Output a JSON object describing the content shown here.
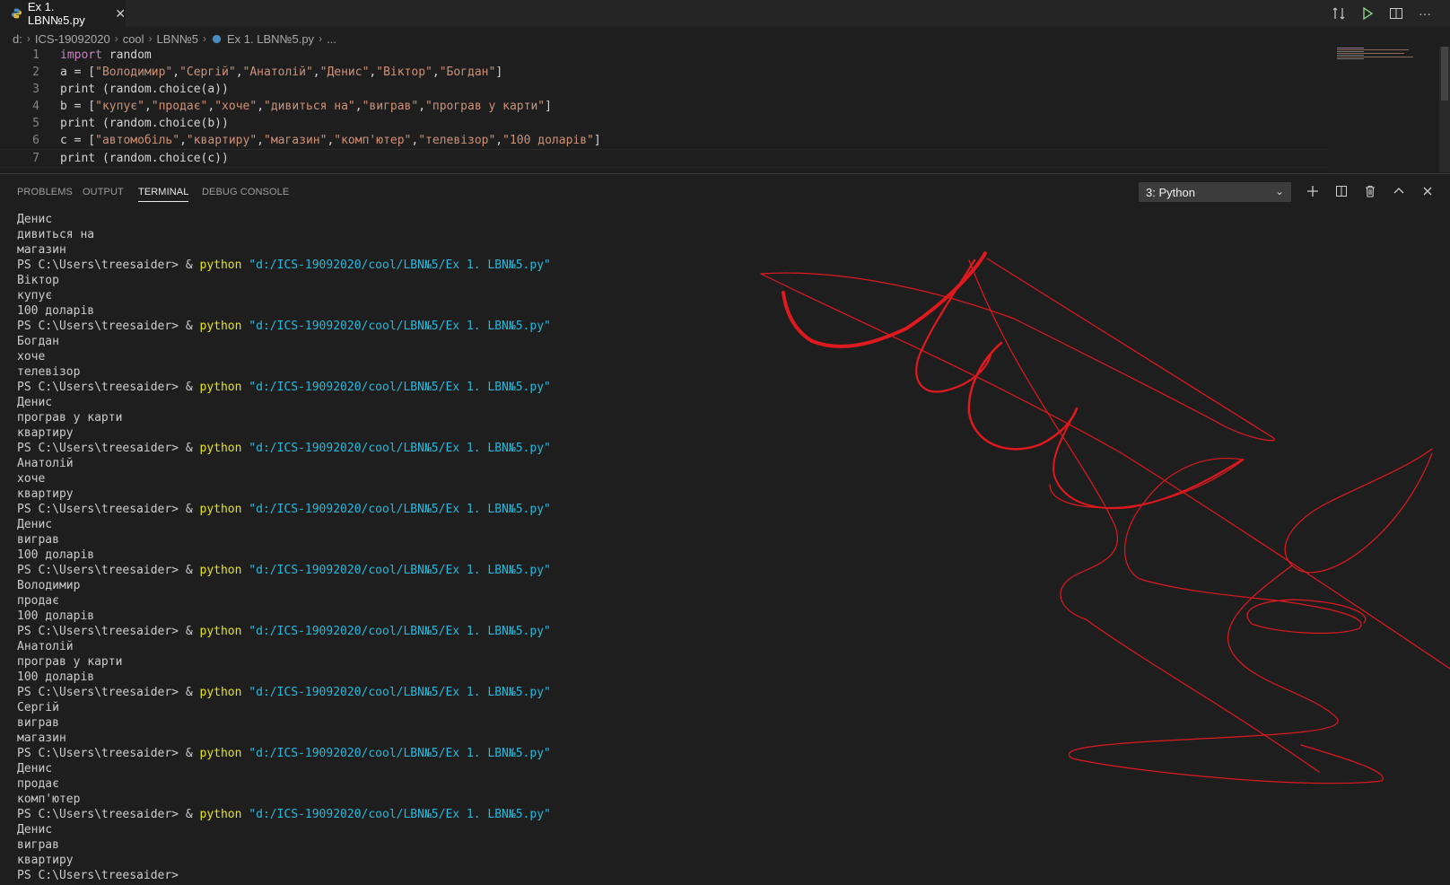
{
  "tab": {
    "label": "Ex 1. LBN№5.py",
    "close_icon": "close-icon"
  },
  "title_actions": [
    {
      "name": "open-changes-icon",
      "glyph": "⇄"
    },
    {
      "name": "run-icon",
      "glyph": "▷"
    },
    {
      "name": "split-editor-icon",
      "glyph": "◫"
    },
    {
      "name": "more-actions-icon",
      "glyph": "···"
    }
  ],
  "breadcrumb": [
    "d:",
    "ICS-19092020",
    "cool",
    "LBN№5",
    "Ex 1. LBN№5.py",
    "..."
  ],
  "editor": {
    "lines": [
      {
        "num": "1",
        "code": [
          {
            "t": "kw",
            "v": "import"
          },
          {
            "t": "p",
            "v": " random"
          }
        ]
      },
      {
        "num": "2",
        "code": [
          {
            "t": "p",
            "v": "a = ["
          },
          {
            "t": "str",
            "v": "\"Володимир\""
          },
          {
            "t": "p",
            "v": ","
          },
          {
            "t": "str",
            "v": "\"Сергій\""
          },
          {
            "t": "p",
            "v": ","
          },
          {
            "t": "str",
            "v": "\"Анатолій\""
          },
          {
            "t": "p",
            "v": ","
          },
          {
            "t": "str",
            "v": "\"Денис\""
          },
          {
            "t": "p",
            "v": ","
          },
          {
            "t": "str",
            "v": "\"Віктор\""
          },
          {
            "t": "p",
            "v": ","
          },
          {
            "t": "str",
            "v": "\"Богдан\""
          },
          {
            "t": "p",
            "v": "]"
          }
        ]
      },
      {
        "num": "3",
        "code": [
          {
            "t": "p",
            "v": "print (random.choice(a))"
          }
        ]
      },
      {
        "num": "4",
        "code": [
          {
            "t": "p",
            "v": "b = ["
          },
          {
            "t": "str",
            "v": "\"купує\""
          },
          {
            "t": "p",
            "v": ","
          },
          {
            "t": "str",
            "v": "\"продає\""
          },
          {
            "t": "p",
            "v": ","
          },
          {
            "t": "str",
            "v": "\"хоче\""
          },
          {
            "t": "p",
            "v": ","
          },
          {
            "t": "str",
            "v": "\"дивиться на\""
          },
          {
            "t": "p",
            "v": ","
          },
          {
            "t": "str",
            "v": "\"виграв\""
          },
          {
            "t": "p",
            "v": ","
          },
          {
            "t": "str",
            "v": "\"програв у карти\""
          },
          {
            "t": "p",
            "v": "]"
          }
        ]
      },
      {
        "num": "5",
        "code": [
          {
            "t": "p",
            "v": "print (random.choice(b))"
          }
        ]
      },
      {
        "num": "6",
        "code": [
          {
            "t": "p",
            "v": "c = ["
          },
          {
            "t": "str",
            "v": "\"автомобіль\""
          },
          {
            "t": "p",
            "v": ","
          },
          {
            "t": "str",
            "v": "\"квартиру\""
          },
          {
            "t": "p",
            "v": ","
          },
          {
            "t": "str",
            "v": "\"магазин\""
          },
          {
            "t": "p",
            "v": ","
          },
          {
            "t": "str",
            "v": "\"комп'ютер\""
          },
          {
            "t": "p",
            "v": ","
          },
          {
            "t": "str",
            "v": "\"телевізор\""
          },
          {
            "t": "p",
            "v": ","
          },
          {
            "t": "str",
            "v": "\"100 доларів\""
          },
          {
            "t": "p",
            "v": "]"
          }
        ]
      },
      {
        "num": "7",
        "code": [
          {
            "t": "p",
            "v": "print (random.choice(c))"
          }
        ]
      }
    ]
  },
  "panel": {
    "tabs": [
      "PROBLEMS",
      "OUTPUT",
      "TERMINAL",
      "DEBUG CONSOLE"
    ],
    "active_tab": "TERMINAL",
    "terminal_select": "3: Python",
    "actions": [
      {
        "name": "new-terminal-icon",
        "glyph": "+"
      },
      {
        "name": "split-terminal-icon",
        "glyph": "◫"
      },
      {
        "name": "kill-terminal-icon",
        "glyph": "🗑"
      },
      {
        "name": "maximize-panel-icon",
        "glyph": "⌃"
      },
      {
        "name": "close-panel-icon",
        "glyph": "✕"
      }
    ]
  },
  "terminal": {
    "prompt": "PS C:\\Users\\treesaider> ",
    "amp": "& ",
    "cmd": "python",
    "path": " \"d:/ICS-19092020/cool/LBN№5/Ex 1. LBN№5.py\"",
    "lines": [
      {
        "type": "out",
        "text": "Денис"
      },
      {
        "type": "out",
        "text": "дивиться на"
      },
      {
        "type": "out",
        "text": "магазин"
      },
      {
        "type": "cmd"
      },
      {
        "type": "out",
        "text": "Віктор"
      },
      {
        "type": "out",
        "text": "купує"
      },
      {
        "type": "out",
        "text": "100 доларів"
      },
      {
        "type": "cmd"
      },
      {
        "type": "out",
        "text": "Богдан"
      },
      {
        "type": "out",
        "text": "хоче"
      },
      {
        "type": "out",
        "text": "телевізор"
      },
      {
        "type": "cmd"
      },
      {
        "type": "out",
        "text": "Денис"
      },
      {
        "type": "out",
        "text": "програв у карти"
      },
      {
        "type": "out",
        "text": "квартиру"
      },
      {
        "type": "cmd"
      },
      {
        "type": "out",
        "text": "Анатолій"
      },
      {
        "type": "out",
        "text": "хоче"
      },
      {
        "type": "out",
        "text": "квартиру"
      },
      {
        "type": "cmd"
      },
      {
        "type": "out",
        "text": "Денис"
      },
      {
        "type": "out",
        "text": "виграв"
      },
      {
        "type": "out",
        "text": "100 доларів"
      },
      {
        "type": "cmd"
      },
      {
        "type": "out",
        "text": "Володимир"
      },
      {
        "type": "out",
        "text": "продає"
      },
      {
        "type": "out",
        "text": "100 доларів"
      },
      {
        "type": "cmd"
      },
      {
        "type": "out",
        "text": "Анатолій"
      },
      {
        "type": "out",
        "text": "програв у карти"
      },
      {
        "type": "out",
        "text": "100 доларів"
      },
      {
        "type": "cmd"
      },
      {
        "type": "out",
        "text": "Сергій"
      },
      {
        "type": "out",
        "text": "виграв"
      },
      {
        "type": "out",
        "text": "магазин"
      },
      {
        "type": "cmd"
      },
      {
        "type": "out",
        "text": "Денис"
      },
      {
        "type": "out",
        "text": "продає"
      },
      {
        "type": "out",
        "text": "комп'ютер"
      },
      {
        "type": "cmd"
      },
      {
        "type": "out",
        "text": "Денис"
      },
      {
        "type": "out",
        "text": "виграв"
      },
      {
        "type": "out",
        "text": "квартиру"
      },
      {
        "type": "prompt"
      }
    ]
  },
  "colors": {
    "keyword": "#c586c0",
    "string": "#ce9178",
    "python_cmd": "#e5e510",
    "path": "#29b8db",
    "scribble": "#e0191f"
  }
}
